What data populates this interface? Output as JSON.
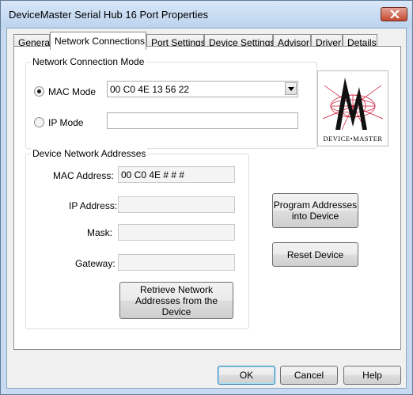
{
  "window": {
    "title": "DeviceMaster Serial Hub 16 Port Properties"
  },
  "tabs": [
    {
      "label": "General"
    },
    {
      "label": "Network Connections"
    },
    {
      "label": "Port Settings"
    },
    {
      "label": "Device Settings"
    },
    {
      "label": "Advisor"
    },
    {
      "label": "Driver"
    },
    {
      "label": "Details"
    }
  ],
  "network_connection_mode": {
    "group_label": "Network Connection Mode",
    "mac_mode_label": "MAC Mode",
    "mac_mode_value": "00 C0 4E 13 56 22",
    "ip_mode_label": "IP Mode",
    "ip_mode_value": "",
    "selected": "MAC Mode"
  },
  "device_network_addresses": {
    "group_label": "Device Network Addresses",
    "mac_address_label": "MAC Address:",
    "mac_address_value": "00 C0 4E # # #",
    "ip_address_label": "IP Address:",
    "ip_address_value": "",
    "mask_label": "Mask:",
    "mask_value": "",
    "gateway_label": "Gateway:",
    "gateway_value": "",
    "retrieve_button_line1": "Retrieve Network",
    "retrieve_button_line2": "Addresses from the Device"
  },
  "side_buttons": {
    "program_line1": "Program Addresses",
    "program_line2": "into Device",
    "reset": "Reset Device"
  },
  "logo": {
    "text": "DEVICE•MASTER"
  },
  "footer": {
    "ok": "OK",
    "cancel": "Cancel",
    "help": "Help"
  },
  "colors": {
    "accent": "#3c7fb1",
    "logo_red": "#c8102e"
  }
}
